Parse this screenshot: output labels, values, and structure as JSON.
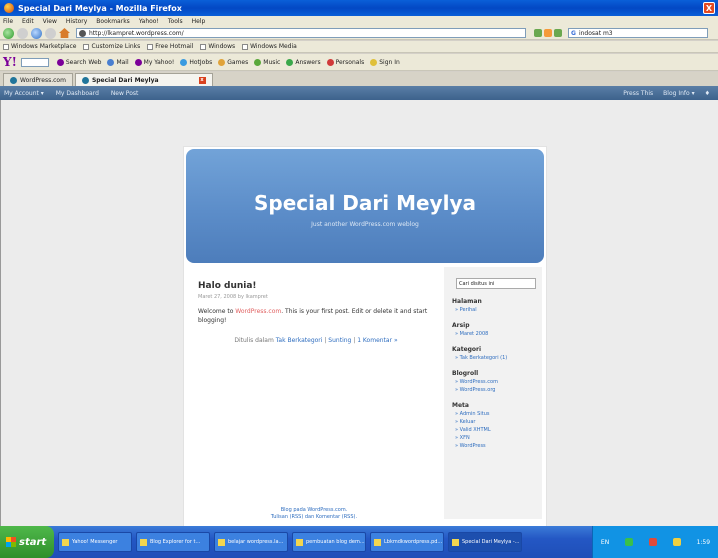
{
  "window": {
    "title": "Special Dari Meylya - Mozilla Firefox",
    "close": "X"
  },
  "menu": [
    "File",
    "Edit",
    "View",
    "History",
    "Bookmarks",
    "Yahoo!",
    "Tools",
    "Help"
  ],
  "nav": {
    "url": "http://lkampret.wordpress.com/",
    "search_placeholder": "indosat m3",
    "search_engine": "G"
  },
  "bookmarks": [
    "Windows Marketplace",
    "Customize Links",
    "Free Hotmail",
    "Windows",
    "Windows Media"
  ],
  "yahoo": {
    "logo": "Y!",
    "items": [
      "Search Web",
      "Mail",
      "My Yahoo!",
      "HotJobs",
      "Games",
      "Music",
      "Answers",
      "Personals",
      "Sign In"
    ]
  },
  "tabs": [
    {
      "label": "WordPress.com"
    },
    {
      "label": "Special Dari Meylya",
      "close": "x"
    }
  ],
  "adminbar": {
    "left": [
      "My Account ▾",
      "My Dashboard",
      "New Post"
    ],
    "right": [
      "Press This",
      "Blog Info ▾",
      "♦"
    ]
  },
  "blog": {
    "title": "Special Dari Meylya",
    "description": "Just another WordPress.com weblog",
    "post": {
      "title": "Halo dunia!",
      "meta": "Maret 27, 2008 by lkampret",
      "body_before": "Welcome to ",
      "body_link": "WordPress.com",
      "body_after": ". This is your first post. Edit or delete it and start blogging!",
      "footer_before": "Ditulis dalam ",
      "footer_category": "Tak Berkategori",
      "footer_sep1": " | ",
      "footer_edit": "Sunting",
      "footer_sep2": " | ",
      "footer_comments": "1 Komentar »"
    },
    "sidebar": {
      "search_placeholder": "Cari disitus ini",
      "halaman_title": "Halaman",
      "halaman": [
        "Perihal"
      ],
      "arsip_title": "Arsip",
      "arsip": [
        "Maret 2008"
      ],
      "kategori_title": "Kategori",
      "kategori": [
        "Tak Berkategori (1)"
      ],
      "blogroll_title": "Blogroll",
      "blogroll": [
        "WordPress.com",
        "WordPress.org"
      ],
      "meta_title": "Meta",
      "meta": [
        "Admin Situs",
        "Keluar",
        "Valid XHTML",
        "XFN",
        "WordPress"
      ]
    },
    "footer_line1": "Blog pada WordPress.com.",
    "footer_line2": "Tulisan (RSS) dan Komentar (RSS)."
  },
  "taskbar": {
    "start": "start",
    "buttons": [
      "Yahoo! Messenger",
      "Blog Explorer for t...",
      "belajar wordpress.la...",
      "pembuatan blog dem...",
      "Lbkmdkwordpress.pd...",
      "Special Dari Meylya -..."
    ],
    "tray_label": "EN",
    "clock": "1:59"
  },
  "colors": {
    "header": "#5c8dc9",
    "link": "#2e6dbf",
    "taskbar": "#2457c4"
  }
}
